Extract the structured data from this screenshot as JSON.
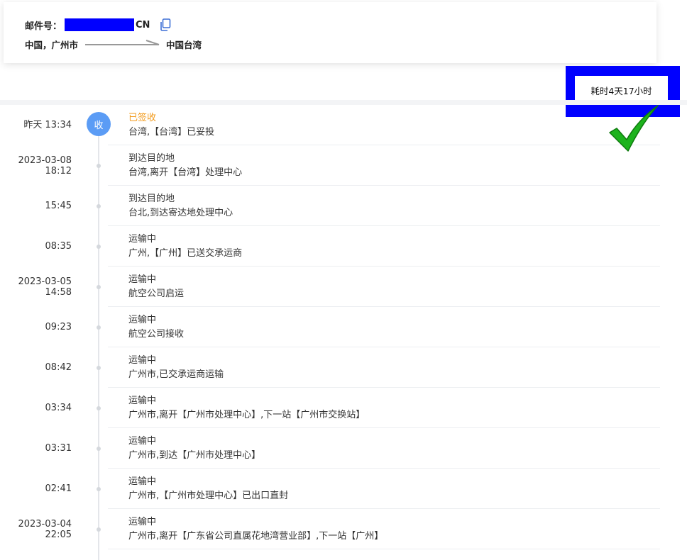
{
  "header": {
    "mail_label": "邮件号：",
    "mail_suffix": "CN",
    "origin": "中国，广州市",
    "destination": "中国台湾"
  },
  "duration": {
    "label": "耗时4天17小时"
  },
  "colors": {
    "redaction": "#0000ff",
    "badge": "#5b9cf5",
    "delivered_status": "#f29c1f",
    "checkmark": "#1db31d"
  },
  "icons": {
    "copy": "copy-icon",
    "arrow": "arrow-right-icon",
    "check": "checkmark-icon"
  },
  "badge_label": "收",
  "events": [
    {
      "date": "",
      "time": "昨天 13:34",
      "status": "已签收",
      "detail": "台湾,【台湾】已妥投"
    },
    {
      "date": "2023-03-08",
      "time": "18:12",
      "status": "到达目的地",
      "detail": "台湾,离开【台湾】处理中心"
    },
    {
      "date": "",
      "time": "15:45",
      "status": "到达目的地",
      "detail": "台北,到达寄达地处理中心"
    },
    {
      "date": "",
      "time": "08:35",
      "status": "运输中",
      "detail": "广州,【广州】已送交承运商"
    },
    {
      "date": "2023-03-05",
      "time": "14:58",
      "status": "运输中",
      "detail": "航空公司启运"
    },
    {
      "date": "",
      "time": "09:23",
      "status": "运输中",
      "detail": "航空公司接收"
    },
    {
      "date": "",
      "time": "08:42",
      "status": "运输中",
      "detail": "广州市,已交承运商运输"
    },
    {
      "date": "",
      "time": "03:34",
      "status": "运输中",
      "detail": "广州市,离开【广州市处理中心】,下一站【广州市交换站】"
    },
    {
      "date": "",
      "time": "03:31",
      "status": "运输中",
      "detail": "广州市,到达【广州市处理中心】"
    },
    {
      "date": "",
      "time": "02:41",
      "status": "运输中",
      "detail": "广州市,【广州市处理中心】已出口直封"
    },
    {
      "date": "2023-03-04",
      "time": "22:05",
      "status": "运输中",
      "detail": "广州市,离开【广东省公司直属花地湾营业部】,下一站【广州】"
    }
  ]
}
